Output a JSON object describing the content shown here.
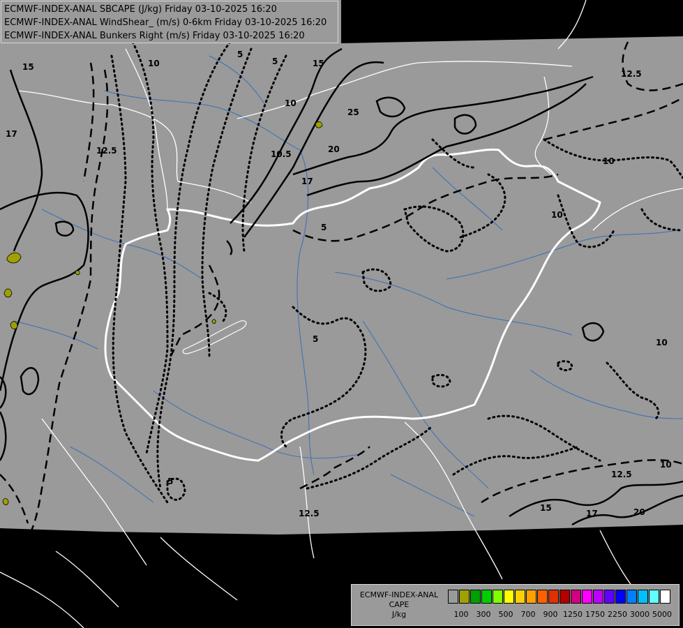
{
  "header": {
    "line1": "ECMWF-INDEX-ANAL SBCAPE (J/kg) Friday 03-10-2025 16:20",
    "line2": "ECMWF-INDEX-ANAL WindShear_ (m/s) 0-6km Friday 03-10-2025 16:20",
    "line3": "ECMWF-INDEX-ANAL Bunkers Right (m/s) Friday 03-10-2025 16:20"
  },
  "contour_labels": [
    "15",
    "10",
    "5",
    "17",
    "12.5",
    "5",
    "10",
    "15",
    "25",
    "20",
    "17",
    "10.5",
    "12.5",
    "10",
    "10",
    "5",
    "5",
    "5",
    "10",
    "12.5",
    "15",
    "17",
    "20",
    "10",
    "12.5"
  ],
  "legend": {
    "title_line1": "ECMWF-INDEX-ANAL",
    "title_line2": "CAPE",
    "title_line3": "J/kg",
    "colors": [
      "#9a9a9a",
      "#a0a000",
      "#00a000",
      "#00d000",
      "#80ff00",
      "#ffff00",
      "#ffd000",
      "#ffa000",
      "#ff6000",
      "#e03000",
      "#b00000",
      "#d00080",
      "#ff00ff",
      "#c000ff",
      "#6000ff",
      "#0000ff",
      "#0080ff",
      "#00c0ff",
      "#60ffff",
      "#ffffff"
    ],
    "ticks": [
      "100",
      "300",
      "500",
      "700",
      "900",
      "1250",
      "1750",
      "2250",
      "3000",
      "5000"
    ]
  },
  "colors": {
    "background": "#000000",
    "domain": "#9a9a9a",
    "borders": "#ffffff",
    "rivers": "#3a6fb5",
    "cape_low": "#a0a000"
  }
}
